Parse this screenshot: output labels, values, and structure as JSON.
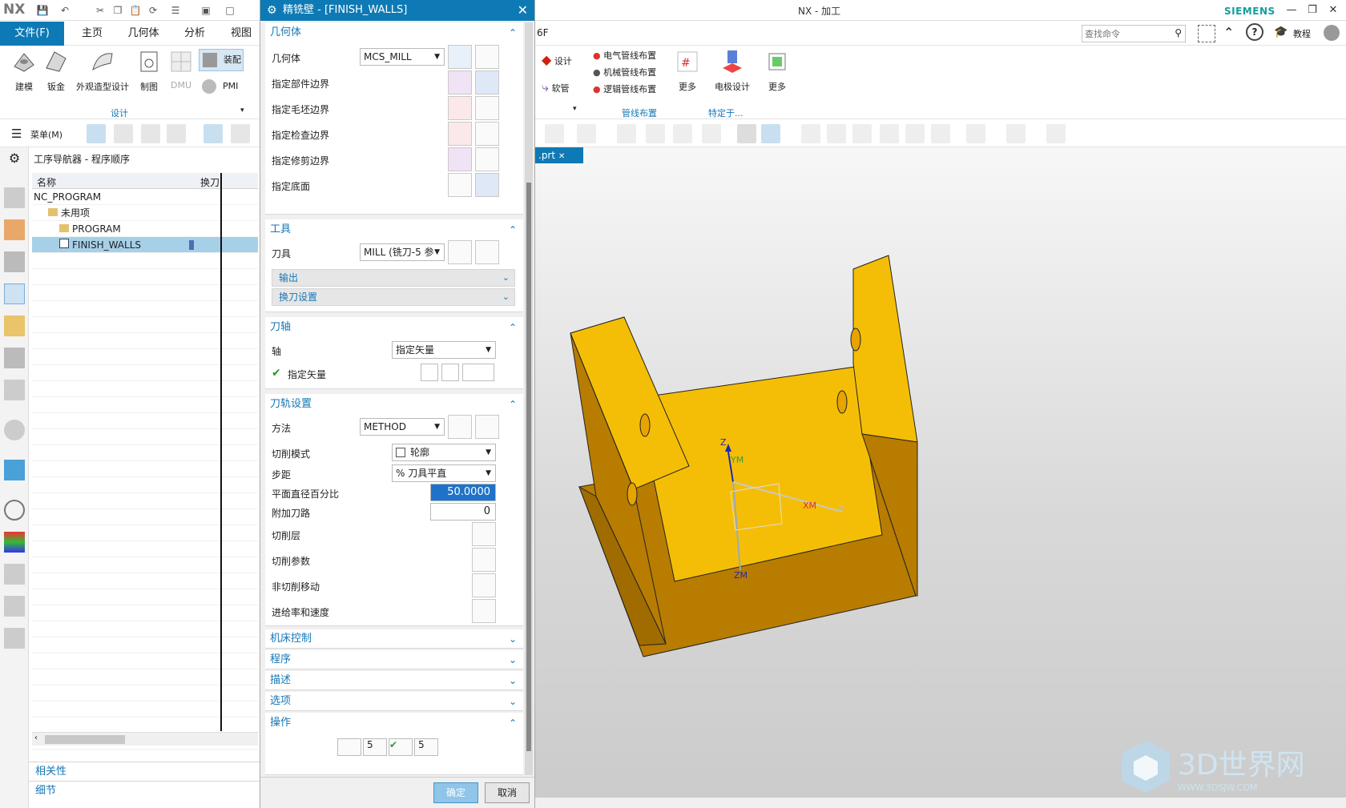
{
  "app": {
    "logo": "NX",
    "title": "NX - 加工",
    "brand": "SIEMENS"
  },
  "menu_tabs": [
    {
      "label": "文件(F)",
      "active": true
    },
    {
      "label": "主页"
    },
    {
      "label": "几何体"
    },
    {
      "label": "分析"
    },
    {
      "label": "视图"
    }
  ],
  "ribbon": {
    "left_buttons": [
      "建模",
      "钣金",
      "外观造型设计",
      "制图",
      "DMU"
    ],
    "assembly": "装配",
    "pmi": "PMI",
    "group_design": "设计",
    "right_left": [
      "设计",
      "软管"
    ],
    "pipe_items": [
      "电气管线布置",
      "机械管线布置",
      "逻辑管线布置"
    ],
    "more1": "更多",
    "group_pipe": "管线布置",
    "electrode": "电极设计",
    "group_specific": "特定于...",
    "more2": "更多",
    "stub": "6F",
    "search_placeholder": "查找命令",
    "tutorial": "教程"
  },
  "toolbar2": {
    "menu": "菜单(M)"
  },
  "navigator": {
    "title": "工序导航器 - 程序顺序",
    "col_name": "名称",
    "col_tool": "换刀",
    "rows": [
      {
        "name": "NC_PROGRAM",
        "indent": 0
      },
      {
        "name": "未用项",
        "indent": 1
      },
      {
        "name": "PROGRAM",
        "indent": 2
      },
      {
        "name": "FINISH_WALLS",
        "indent": 2,
        "selected": true
      }
    ],
    "bottom_sections": [
      "相关性",
      "细节"
    ]
  },
  "dialog": {
    "title": "精铣壁 - [FINISH_WALLS]",
    "geometry": {
      "header": "几何体",
      "label": "几何体",
      "value": "MCS_MILL",
      "items": [
        "指定部件边界",
        "指定毛坯边界",
        "指定检查边界",
        "指定修剪边界",
        "指定底面"
      ]
    },
    "tool": {
      "header": "工具",
      "label": "刀具",
      "value": "MILL (铣刀-5 参",
      "output": "输出",
      "change": "换刀设置"
    },
    "axis": {
      "header": "刀轴",
      "label": "轴",
      "value": "指定矢量",
      "specify": "指定矢量"
    },
    "path": {
      "header": "刀轨设置",
      "method_label": "方法",
      "method": "METHOD",
      "cut_mode_label": "切削模式",
      "cut_mode": "轮廓",
      "step_label": "步距",
      "step": "% 刀具平直",
      "percent_label": "平面直径百分比",
      "percent": "50.0000",
      "extra_label": "附加刀路",
      "extra": "0",
      "layers": "切削层",
      "params": "切削参数",
      "noncut": "非切削移动",
      "feeds": "进给率和速度"
    },
    "collapsed": [
      "机床控制",
      "程序",
      "描述",
      "选项"
    ],
    "ops": {
      "header": "操作",
      "b1": "5",
      "b2": "5"
    },
    "ok": "确定",
    "cancel": "取消"
  },
  "viewport": {
    "tab": ".prt",
    "axes": {
      "z": "Z",
      "ym": "YM",
      "xm": "XM",
      "x": "X",
      "zm": "ZM"
    }
  },
  "watermark": {
    "text": "3D世界网",
    "url": "WWW.3DSJW.COM"
  },
  "colors": {
    "accent": "#0e7ab5",
    "part_top": "#f5be06",
    "part_side": "#b87c00"
  }
}
